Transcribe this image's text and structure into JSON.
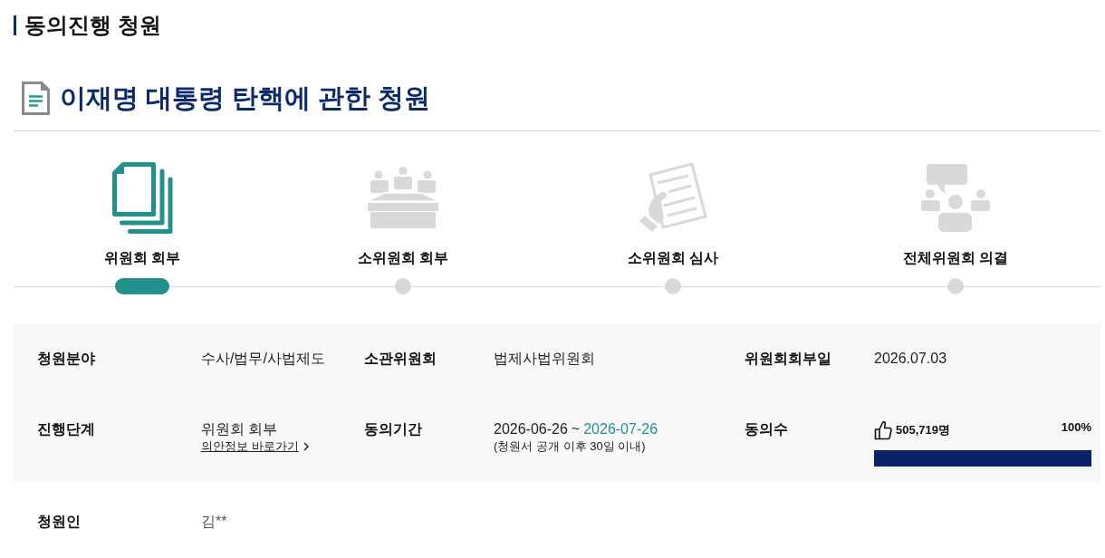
{
  "page_heading": "동의진행 청원",
  "petition": {
    "title": "이재명 대통령 탄핵에 관한 청원"
  },
  "steps": [
    {
      "kind": "documents",
      "label": "위원회 회부",
      "selected": true
    },
    {
      "kind": "meeting",
      "label": "소위원회 회부",
      "selected": false
    },
    {
      "kind": "review",
      "label": "소위원회 심사",
      "selected": false
    },
    {
      "kind": "discussion",
      "label": "전체위원회 의결",
      "selected": false
    }
  ],
  "summary": {
    "fields": [
      {
        "kind": "text",
        "label": "청원분야",
        "value": "수사/법무/사법제도"
      },
      {
        "kind": "text",
        "label": "소관위원회",
        "value": "법제사법위원회"
      },
      {
        "kind": "text",
        "label": "위원회회부일",
        "value": "2026.07.03"
      },
      {
        "kind": "stage",
        "label": "진행단계",
        "value": "위원회 회부",
        "link": "의안정보 바로가기"
      },
      {
        "kind": "period",
        "label": "동의기간",
        "start": "2026-06-26",
        "separator": "~",
        "end": "2026-07-26",
        "note": "(청원서 공개 이후 30일 이내)"
      },
      {
        "kind": "votes",
        "label": "동의수",
        "count": "505,719명",
        "percent": "100%",
        "level": 1
      }
    ]
  },
  "petitioner": {
    "label": "청원인",
    "value": "김**"
  }
}
